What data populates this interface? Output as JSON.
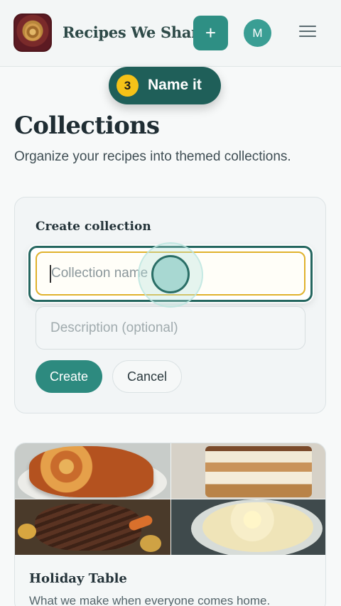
{
  "header": {
    "brand": "Recipes We Share",
    "add_glyph": "+",
    "avatar_initial": "M",
    "icons": {
      "logo": "tree-emblem-logo",
      "add": "plus-icon",
      "menu": "hamburger-menu-icon"
    }
  },
  "callout": {
    "step_number": "3",
    "text": "Name it"
  },
  "page": {
    "title": "Collections",
    "subtitle": "Organize your recipes into themed collections."
  },
  "create_form": {
    "title": "Create collection",
    "name_placeholder": "Collection name",
    "name_value": "",
    "description_placeholder": "Description (optional)",
    "description_value": "",
    "create_label": "Create",
    "cancel_label": "Cancel"
  },
  "collections": [
    {
      "title": "Holiday Table",
      "description": "What we make when everyone comes home."
    }
  ],
  "colors": {
    "accent": "#2d8a7f",
    "callout_bg": "#1f5f59",
    "step_badge": "#f5c218",
    "focus_border": "#e0b22c"
  }
}
